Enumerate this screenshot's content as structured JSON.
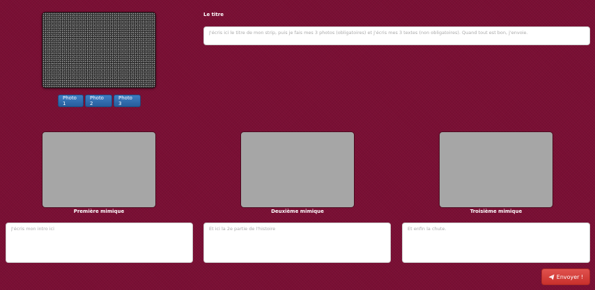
{
  "camera": {
    "icon": "camera-preview"
  },
  "photo_buttons": [
    {
      "label": "Photo 1"
    },
    {
      "label": "Photo 2"
    },
    {
      "label": "Photo 3"
    }
  ],
  "title_section": {
    "label": "Le titre",
    "placeholder": "J'écris ici le titre de mon strip, puis je fais mes 3 photos (obligatoires) et j'écris mes 3 textes (non obligatoires). Quand tout est bon, j'envoie."
  },
  "mimics": [
    {
      "label": "Première mimique"
    },
    {
      "label": "Deuxième mimique"
    },
    {
      "label": "Troisième mimique"
    }
  ],
  "text_fields": [
    {
      "placeholder": "J'écris mon intro ici"
    },
    {
      "placeholder": "Et ici la 2e partie de l'histoire"
    },
    {
      "placeholder": "Et enfin la chute."
    }
  ],
  "send": {
    "label": "Envoyer !",
    "icon": "send-icon"
  },
  "colors": {
    "background": "#7a0f34",
    "photo_button": "#285e9c",
    "send_button": "#c9302c",
    "mimic_placeholder": "#a6a6a6"
  }
}
